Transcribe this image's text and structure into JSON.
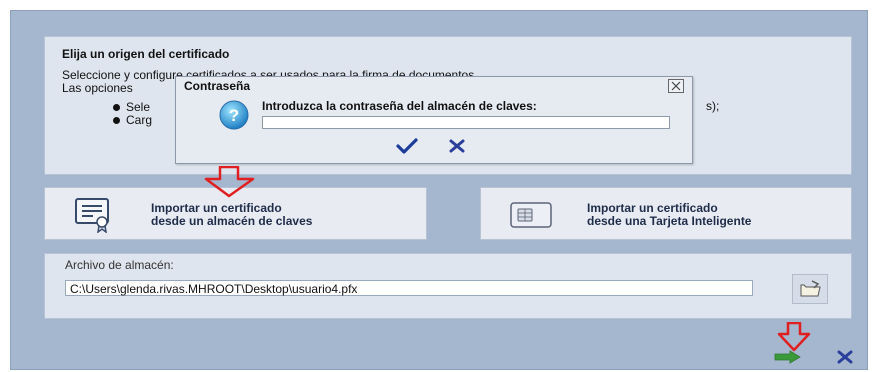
{
  "info": {
    "title": "Elija un origen del certificado",
    "desc_line1": "Seleccione y configure certificados a ser usados para la firma de documentos.",
    "desc_line2": "Las opciones",
    "bullet1": "Sele",
    "bullet2": "Carg",
    "bullet1_suffix": "s);"
  },
  "dialog": {
    "title": "Contraseña",
    "prompt": "Introduzca la contraseña del almacén de claves:",
    "password_value": ""
  },
  "import_store": {
    "line1": "Importar un certificado",
    "line2": "desde un almacén de claves"
  },
  "import_smartcard": {
    "line1": "Importar un certificado",
    "line2": "desde una Tarjeta Inteligente"
  },
  "store": {
    "label": "Archivo de almacén:",
    "path": "C:\\Users\\glenda.rivas.MHROOT\\Desktop\\usuario4.pfx"
  },
  "colors": {
    "frame": "#a5b6cf",
    "panel": "#dfe5ee",
    "arrow_red": "#e02020",
    "check_blue": "#1c3c9a",
    "next_green": "#3a9a3a"
  },
  "icons": [
    "help-icon",
    "certificate-icon",
    "smartcard-icon",
    "folder-icon",
    "check-icon",
    "cancel-icon",
    "next-arrow-icon",
    "close-icon",
    "red-arrow-icon"
  ]
}
